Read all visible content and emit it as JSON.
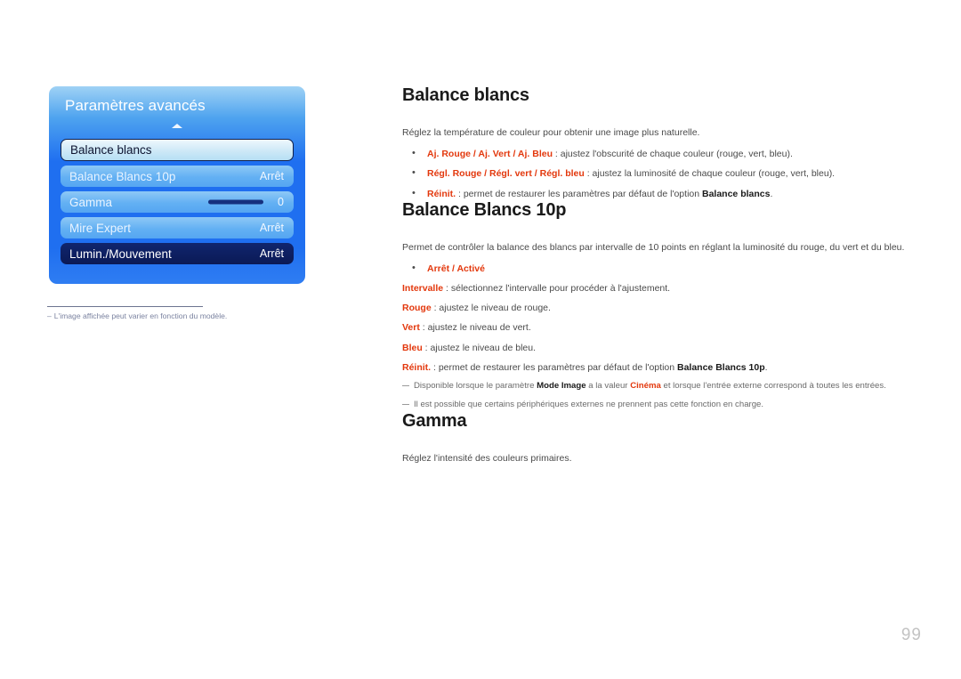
{
  "osd": {
    "title": "Paramètres avancés",
    "scroll_indicator": "up-arrow",
    "rows": [
      {
        "label": "Balance blancs",
        "value": "",
        "state": "focused"
      },
      {
        "label": "Balance Blancs 10p",
        "value": "Arrêt",
        "state": "normal"
      },
      {
        "label": "Gamma",
        "value": "0",
        "state": "normal",
        "slider": true
      },
      {
        "label": "Mire Expert",
        "value": "Arrêt",
        "state": "normal"
      },
      {
        "label": "Lumin./Mouvement",
        "value": "Arrêt",
        "state": "dark"
      }
    ],
    "footnote_dash": "–",
    "footnote": "L'image affichée peut varier en fonction du modèle."
  },
  "sections": {
    "balance_blancs": {
      "title": "Balance blancs",
      "intro": "Réglez la température de couleur pour obtenir une image plus naturelle.",
      "bullets": [
        {
          "key": "Aj. Rouge / Aj. Vert / Aj. Bleu",
          "rest": " : ajustez l'obscurité de chaque couleur (rouge, vert, bleu)."
        },
        {
          "key": "Régl. Rouge / Régl. vert / Régl. bleu",
          "rest": " : ajustez la luminosité de chaque couleur (rouge, vert, bleu)."
        },
        {
          "key": "Réinit.",
          "rest_a": " : permet de restaurer les paramètres par défaut de l'option ",
          "rest_key": "Balance blancs",
          "rest_b": "."
        }
      ]
    },
    "balance_blancs_10p": {
      "title": "Balance Blancs 10p",
      "intro": "Permet de contrôler la balance des blancs par intervalle de 10 points en réglant la luminosité du rouge, du vert et du bleu.",
      "bullet_options": "Arrêt / Activé",
      "lines": [
        {
          "key": "Intervalle",
          "rest": " : sélectionnez l'intervalle pour procéder à l'ajustement."
        },
        {
          "key": "Rouge",
          "rest": " : ajustez le niveau de rouge."
        },
        {
          "key": "Vert",
          "rest": " : ajustez le niveau de vert."
        },
        {
          "key": "Bleu",
          "rest": " : ajustez le niveau de bleu."
        }
      ],
      "reset": {
        "key": "Réinit.",
        "rest_a": " : permet de restaurer les paramètres par défaut de l'option ",
        "rest_key": "Balance Blancs 10p",
        "rest_b": "."
      },
      "notes": [
        {
          "a": "Disponible lorsque le paramètre ",
          "k1": "Mode Image",
          "b": " a la valeur ",
          "k2": "Cinéma",
          "c": " et lorsque l'entrée externe correspond à toutes les entrées."
        },
        {
          "a": "Il est possible que certains périphériques externes ne prennent pas cette fonction en charge."
        }
      ]
    },
    "gamma": {
      "title": "Gamma",
      "intro": "Réglez l'intensité des couleurs primaires."
    }
  },
  "page_number": "99",
  "colors": {
    "accent_red": "#e3380d",
    "osd_blue": "#1f6ff0",
    "osd_dark": "#0b1a56",
    "body_text": "#4a4a4a"
  }
}
